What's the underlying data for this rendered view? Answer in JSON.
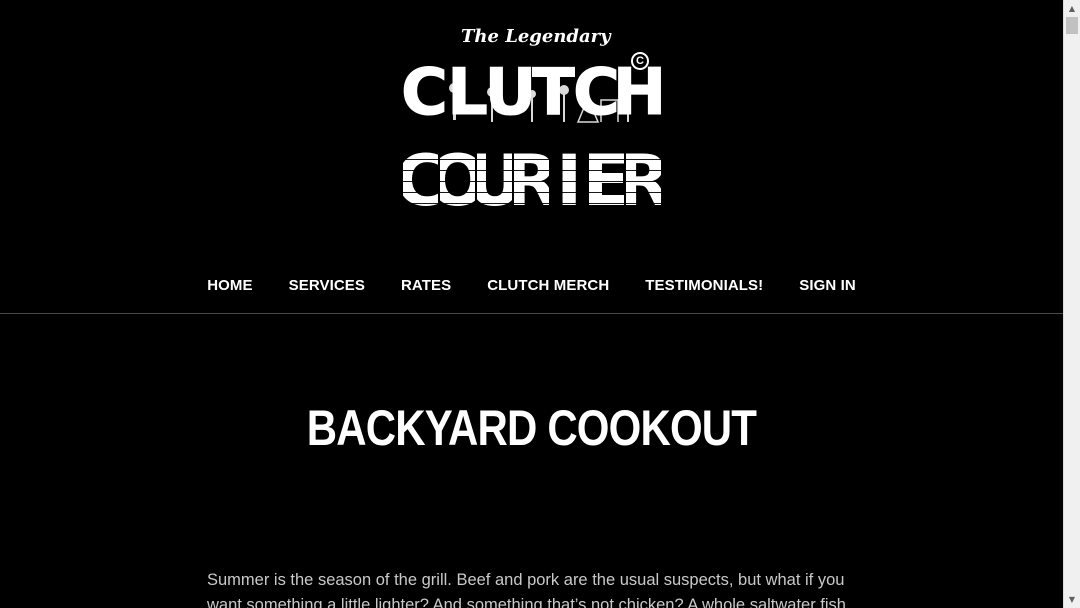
{
  "logo": {
    "tagline": "The Legendary",
    "word1": [
      "C",
      "L",
      "U",
      "T",
      "C",
      "H"
    ],
    "word2": [
      "C",
      "O",
      "U",
      "R",
      "I",
      "E",
      "R"
    ],
    "copyright_mark": "C"
  },
  "nav": {
    "items": [
      {
        "label": "HOME"
      },
      {
        "label": "SERVICES"
      },
      {
        "label": "RATES"
      },
      {
        "label": "CLUTCH MERCH"
      },
      {
        "label": "TESTIMONIALS!"
      },
      {
        "label": "SIGN IN"
      }
    ]
  },
  "post": {
    "title": "BACKYARD COOKOUT",
    "body": "Summer is the season of the grill. Beef and pork are the usual suspects, but what if you want something a little lighter? And something that’s not chicken? A whole saltwater fish"
  },
  "scrollbar": {
    "up_arrow": "▲",
    "down_arrow": "▼",
    "position": 0.0
  },
  "colors": {
    "background": "#000000",
    "text": "#ffffff",
    "body_text": "#c9c9c9",
    "divider": "#4a4a4a"
  }
}
